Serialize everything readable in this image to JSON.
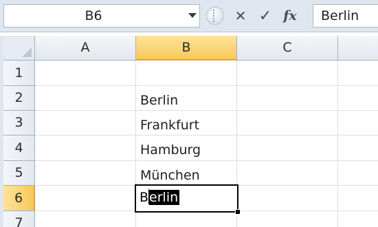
{
  "formula_bar": {
    "name_box": "B6",
    "formula_value": "Berlin",
    "cancel_glyph": "✕",
    "enter_glyph": "✓",
    "fx_glyph": "fx",
    "icons": [
      "chevron-down-icon",
      "grip-icon",
      "cancel-icon",
      "enter-icon",
      "insert-function-icon"
    ]
  },
  "grid": {
    "columns": [
      "A",
      "B",
      "C"
    ],
    "rows": [
      "1",
      "2",
      "3",
      "4",
      "5",
      "6",
      "7"
    ],
    "active_column": "B",
    "active_row": "6",
    "cells": {
      "B2": "Berlin",
      "B3": "Frankfurt",
      "B4": "Hamburg",
      "B5": "München"
    },
    "edit_cell": {
      "ref": "B6",
      "before_caret": "B",
      "selected_text": "erlin"
    }
  },
  "colors": {
    "active_header": "#f8c95a",
    "header": "#e3e8ee",
    "gridline": "#d9dee5",
    "selection": "#000000"
  }
}
